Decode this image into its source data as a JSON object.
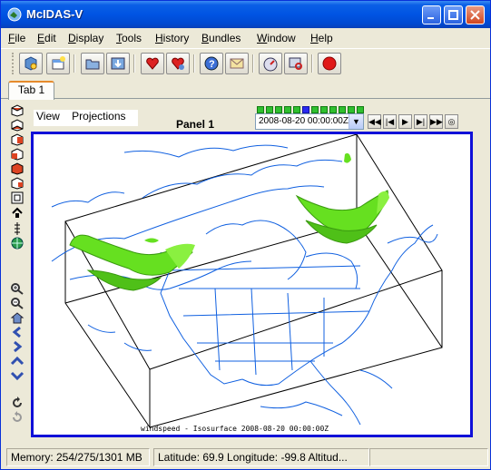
{
  "window": {
    "title": "McIDAS-V"
  },
  "menu": [
    {
      "label": "File",
      "mnemonic": "F",
      "rest": "ile"
    },
    {
      "label": "Edit",
      "mnemonic": "E",
      "rest": "dit"
    },
    {
      "label": "Display",
      "mnemonic": "D",
      "rest": "isplay"
    },
    {
      "label": "Tools",
      "mnemonic": "T",
      "rest": "ools"
    },
    {
      "label": "History",
      "mnemonic": "H",
      "rest": "istory"
    },
    {
      "label": "Bundles",
      "mnemonic": "B",
      "rest": "undles"
    },
    {
      "label": "Window",
      "mnemonic": "W",
      "rest": "indow"
    },
    {
      "label": "Help",
      "mnemonic": "H",
      "rest": "elp"
    }
  ],
  "tabs": [
    {
      "label": "Tab 1"
    }
  ],
  "panel": {
    "view_menu": "View",
    "projections_menu": "Projections",
    "title": "Panel 1",
    "time_value": "2008-08-20 00:00:00Z",
    "time_steps_total": 12,
    "time_step_selected": 6,
    "display_label": "windspeed - Isosurface 2008-08-20 00:00:00Z"
  },
  "status": {
    "memory": "Memory: 254/275/1301 MB",
    "location": "Latitude:  69.9 Longitude:  -99.8 Altitud..."
  },
  "colors": {
    "titlebar": "#0054e3",
    "viewport_border": "#1010d8",
    "map_lines": "#1060e0",
    "isosurface": "#66e020",
    "time_step": "#2fc02f",
    "time_step_selected": "#2a2af0"
  }
}
